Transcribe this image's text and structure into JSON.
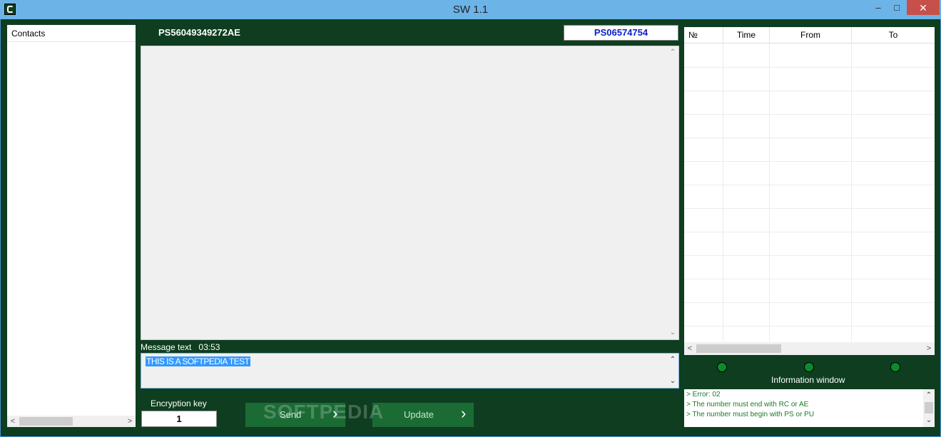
{
  "window": {
    "title": "SW 1.1",
    "minimize": "–",
    "maximize": "□",
    "close": "✕"
  },
  "contacts": {
    "header": "Contacts"
  },
  "conversation": {
    "from_address": "PS56049349272AE",
    "to_address": "PS06574754"
  },
  "message": {
    "label": "Message text",
    "time": "03:53",
    "text": "THIS IS A SOFTPEDIA TEST"
  },
  "encryption": {
    "label": "Encryption key",
    "value": "1"
  },
  "buttons": {
    "send": "Send",
    "update": "Update"
  },
  "watermark": "SOFTPEDIA",
  "grid": {
    "columns": [
      "№",
      "Time",
      "From",
      "To"
    ]
  },
  "info": {
    "label": "Information window",
    "lines": [
      "> Error: 02",
      "> The number must end with RC or AE",
      "> The number must begin with PS or PU"
    ]
  },
  "colors": {
    "background": "#0e3e1f",
    "titlebar": "#6cb3e8",
    "button": "#1b6b35",
    "led": "#0d8a2a",
    "selection": "#3399ff",
    "address_blue": "#0a20c9",
    "info_text": "#1a7a2a"
  }
}
